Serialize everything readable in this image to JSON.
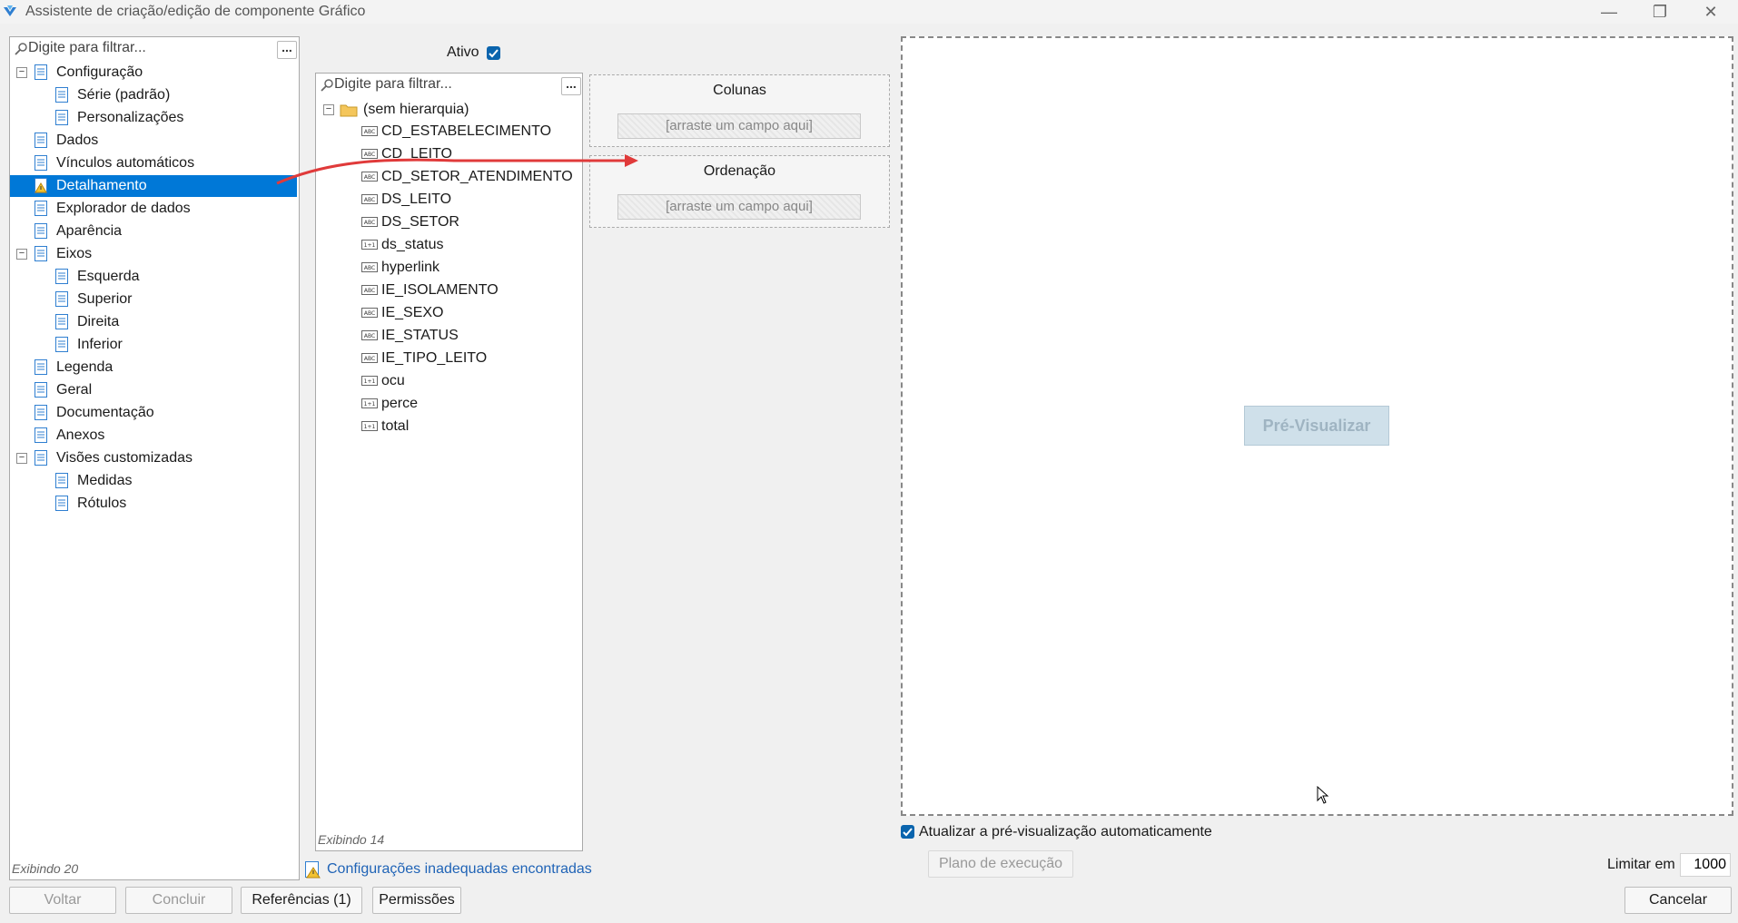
{
  "window": {
    "title": "Assistente de criação/edição de componente Gráfico",
    "controls": [
      "minimize-icon",
      "restore-icon",
      "close-icon"
    ]
  },
  "nav": {
    "filter_placeholder": "Digite para filtrar...",
    "more_label": "...",
    "items": [
      {
        "label": "Configuração"
      },
      {
        "label": "Série (padrão)"
      },
      {
        "label": "Personalizações"
      },
      {
        "label": "Dados"
      },
      {
        "label": "Vínculos automáticos"
      },
      {
        "label": "Detalhamento"
      },
      {
        "label": "Explorador de dados"
      },
      {
        "label": "Aparência"
      },
      {
        "label": "Eixos"
      },
      {
        "label": "Esquerda"
      },
      {
        "label": "Superior"
      },
      {
        "label": "Direita"
      },
      {
        "label": "Inferior"
      },
      {
        "label": "Legenda"
      },
      {
        "label": "Geral"
      },
      {
        "label": "Documentação"
      },
      {
        "label": "Anexos"
      },
      {
        "label": "Visões customizadas"
      },
      {
        "label": "Medidas"
      },
      {
        "label": "Rótulos"
      }
    ],
    "footer": "Exibindo 20"
  },
  "ativo": {
    "label": "Ativo",
    "checked": true
  },
  "fields": {
    "filter_placeholder": "Digite para filtrar...",
    "more_label": "...",
    "root": "(sem hierarquia)",
    "items": [
      {
        "label": "CD_ESTABELECIMENTO",
        "type": "text"
      },
      {
        "label": "CD_LEITO",
        "type": "text"
      },
      {
        "label": "CD_SETOR_ATENDIMENTO",
        "type": "text"
      },
      {
        "label": "DS_LEITO",
        "type": "text"
      },
      {
        "label": "DS_SETOR",
        "type": "text"
      },
      {
        "label": "ds_status",
        "type": "number"
      },
      {
        "label": "hyperlink",
        "type": "text"
      },
      {
        "label": "IE_ISOLAMENTO",
        "type": "text"
      },
      {
        "label": "IE_SEXO",
        "type": "text"
      },
      {
        "label": "IE_STATUS",
        "type": "text"
      },
      {
        "label": "IE_TIPO_LEITO",
        "type": "text"
      },
      {
        "label": "ocu",
        "type": "number"
      },
      {
        "label": "perce",
        "type": "number"
      },
      {
        "label": "total",
        "type": "number"
      }
    ],
    "footer": "Exibindo 14"
  },
  "dropzones": {
    "columns": {
      "title": "Colunas",
      "slot": "[arraste um campo aqui]"
    },
    "ordering": {
      "title": "Ordenação",
      "slot": "[arraste um campo aqui]"
    }
  },
  "warning_link": "Configurações inadequadas encontradas",
  "preview": {
    "button": "Pré-Visualizar",
    "auto_update_label": "Atualizar a pré-visualização automaticamente",
    "auto_update_checked": true,
    "execution_plan": "Plano de execução",
    "limit_label": "Limitar em",
    "limit_value": "1000"
  },
  "footer_buttons": {
    "back": "Voltar",
    "finish": "Concluir",
    "references": "Referências (1)",
    "permissions": "Permissões",
    "cancel": "Cancelar"
  },
  "colors": {
    "selection": "#0078d7",
    "arrow": "#e03a3a",
    "checkbox": "#0a64ad"
  }
}
